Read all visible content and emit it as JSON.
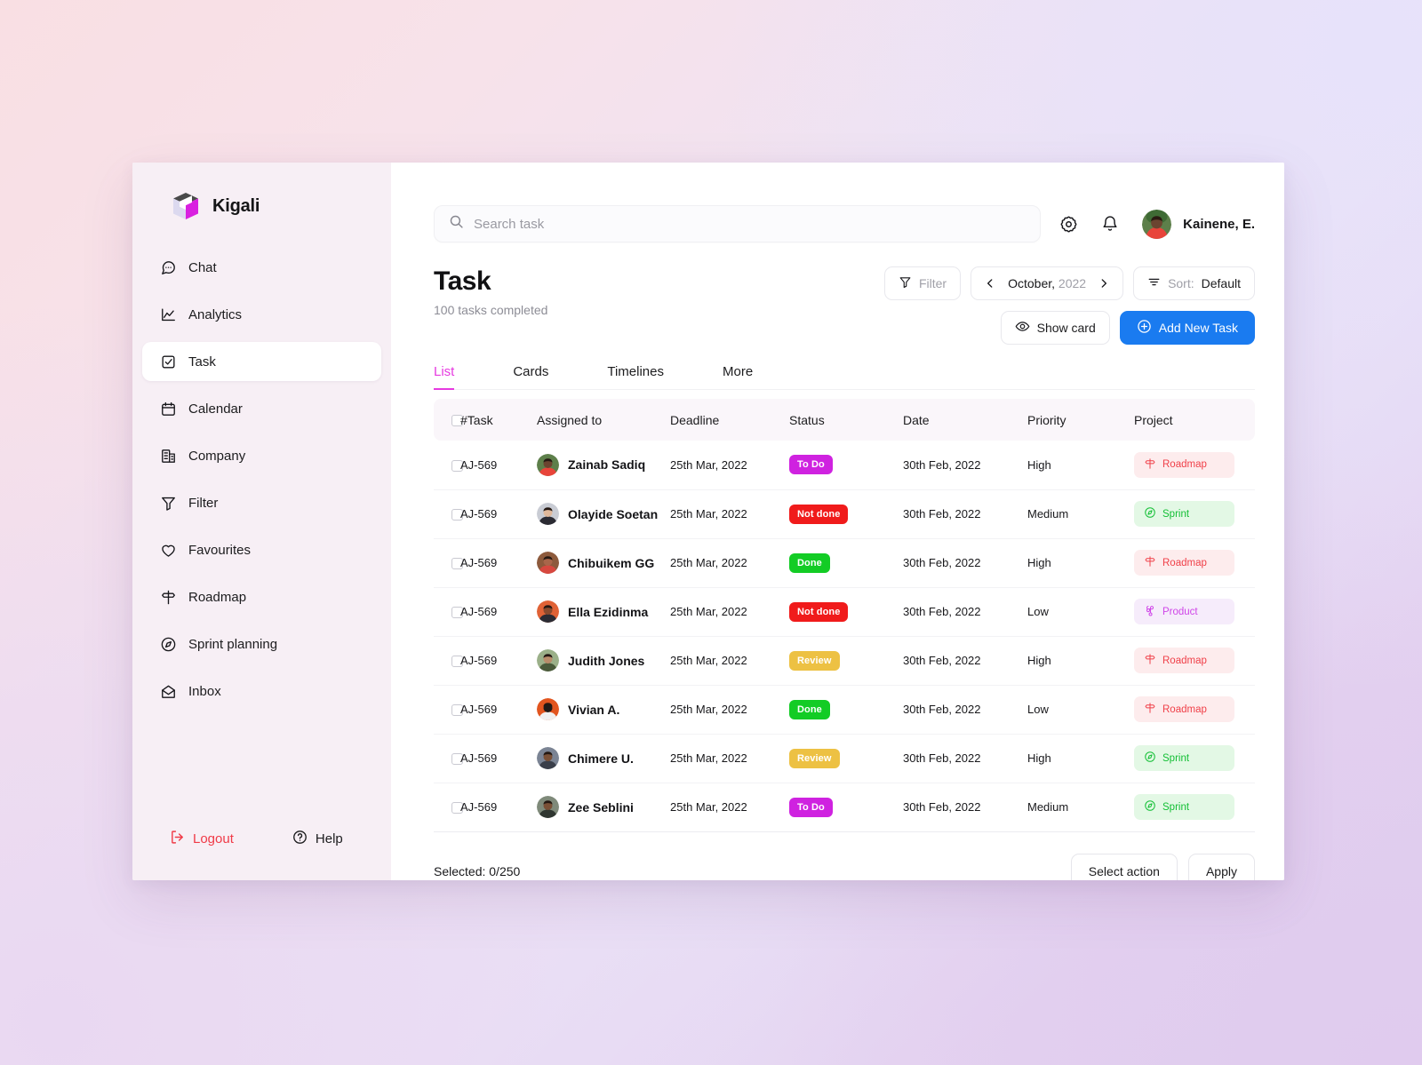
{
  "brand": {
    "name": "Kigali",
    "logo_icon": "cube-logo-icon"
  },
  "sidebar": {
    "items": [
      {
        "label": "Chat",
        "icon": "chat-bubble-icon",
        "active": false
      },
      {
        "label": "Analytics",
        "icon": "line-chart-icon",
        "active": false
      },
      {
        "label": "Task",
        "icon": "task-check-icon",
        "active": true
      },
      {
        "label": "Calendar",
        "icon": "calendar-icon",
        "active": false
      },
      {
        "label": "Company",
        "icon": "building-icon",
        "active": false
      },
      {
        "label": "Filter",
        "icon": "funnel-icon",
        "active": false
      },
      {
        "label": "Favourites",
        "icon": "heart-icon",
        "active": false
      },
      {
        "label": "Roadmap",
        "icon": "signpost-icon",
        "active": false
      },
      {
        "label": "Sprint planning",
        "icon": "compass-icon",
        "active": false
      },
      {
        "label": "Inbox",
        "icon": "envelope-open-icon",
        "active": false
      }
    ],
    "logout": {
      "label": "Logout",
      "icon": "logout-icon",
      "color": "#f03a47"
    },
    "help": {
      "label": "Help",
      "icon": "question-circle-icon"
    }
  },
  "topbar": {
    "search_placeholder": "Search task",
    "search_value": "",
    "search_icon": "search-icon",
    "settings_icon": "gear-icon",
    "notifications_icon": "bell-icon",
    "user_name": "Kainene, E.",
    "avatar_icon": "user-avatar"
  },
  "header": {
    "title": "Task",
    "subtitle": "100 tasks completed",
    "filter_label": "Filter",
    "filter_icon": "funnel-icon",
    "date_month": "October,",
    "date_year": "2022",
    "prev_icon": "chevron-left-icon",
    "next_icon": "chevron-right-icon",
    "sort_prefix": "Sort:",
    "sort_value": "Default",
    "sort_icon": "sort-lines-icon",
    "show_card_label": "Show card",
    "show_card_icon": "eye-icon",
    "add_task_label": "Add New Task",
    "add_task_icon": "plus-circle-icon",
    "accent_color": "#1a7bf0"
  },
  "tabs": [
    {
      "label": "List",
      "active": true
    },
    {
      "label": "Cards",
      "active": false
    },
    {
      "label": "Timelines",
      "active": false
    },
    {
      "label": "More",
      "active": false
    }
  ],
  "tab_accent": "#e63ae0",
  "table": {
    "columns": [
      "#Task",
      "Assigned to",
      "Deadline",
      "Status",
      "Date",
      "Priority",
      "Project"
    ],
    "rows": [
      {
        "task": "AJ-569",
        "assignee": "Zainab Sadiq",
        "deadline": "25th Mar, 2022",
        "status": "To Do",
        "status_key": "todo",
        "date": "30th Feb, 2022",
        "priority": "High",
        "project": "Roadmap",
        "project_key": "roadmap",
        "project_icon": "signpost-icon"
      },
      {
        "task": "AJ-569",
        "assignee": "Olayide Soetan",
        "deadline": "25th Mar, 2022",
        "status": "Not done",
        "status_key": "notdone",
        "date": "30th Feb, 2022",
        "priority": "Medium",
        "project": "Sprint",
        "project_key": "sprint",
        "project_icon": "compass-icon"
      },
      {
        "task": "AJ-569",
        "assignee": "Chibuikem GG",
        "deadline": "25th Mar, 2022",
        "status": "Done",
        "status_key": "done",
        "date": "30th Feb, 2022",
        "priority": "High",
        "project": "Roadmap",
        "project_key": "roadmap",
        "project_icon": "signpost-icon"
      },
      {
        "task": "AJ-569",
        "assignee": "Ella Ezidinma",
        "deadline": "25th Mar, 2022",
        "status": "Not done",
        "status_key": "notdone",
        "date": "30th Feb, 2022",
        "priority": "Low",
        "project": "Product",
        "project_key": "product",
        "project_icon": "command-icon"
      },
      {
        "task": "AJ-569",
        "assignee": "Judith Jones",
        "deadline": "25th Mar, 2022",
        "status": "Review",
        "status_key": "review",
        "date": "30th Feb, 2022",
        "priority": "High",
        "project": "Roadmap",
        "project_key": "roadmap",
        "project_icon": "signpost-icon"
      },
      {
        "task": "AJ-569",
        "assignee": "Vivian A.",
        "deadline": "25th Mar, 2022",
        "status": "Done",
        "status_key": "done",
        "date": "30th Feb, 2022",
        "priority": "Low",
        "project": "Roadmap",
        "project_key": "roadmap",
        "project_icon": "signpost-icon"
      },
      {
        "task": "AJ-569",
        "assignee": "Chimere U.",
        "deadline": "25th Mar, 2022",
        "status": "Review",
        "status_key": "review",
        "date": "30th Feb, 2022",
        "priority": "High",
        "project": "Sprint",
        "project_key": "sprint",
        "project_icon": "compass-icon"
      },
      {
        "task": "AJ-569",
        "assignee": "Zee Seblini",
        "deadline": "25th Mar, 2022",
        "status": "To Do",
        "status_key": "todo",
        "date": "30th Feb, 2022",
        "priority": "Medium",
        "project": "Sprint",
        "project_key": "sprint",
        "project_icon": "compass-icon"
      }
    ]
  },
  "status_colors": {
    "todo": "#cf22e0",
    "notdone": "#f01b1b",
    "done": "#13cc25",
    "review": "#edc143"
  },
  "footer": {
    "selected_label": "Selected: 0/250",
    "select_action_label": "Select action",
    "apply_label": "Apply"
  }
}
